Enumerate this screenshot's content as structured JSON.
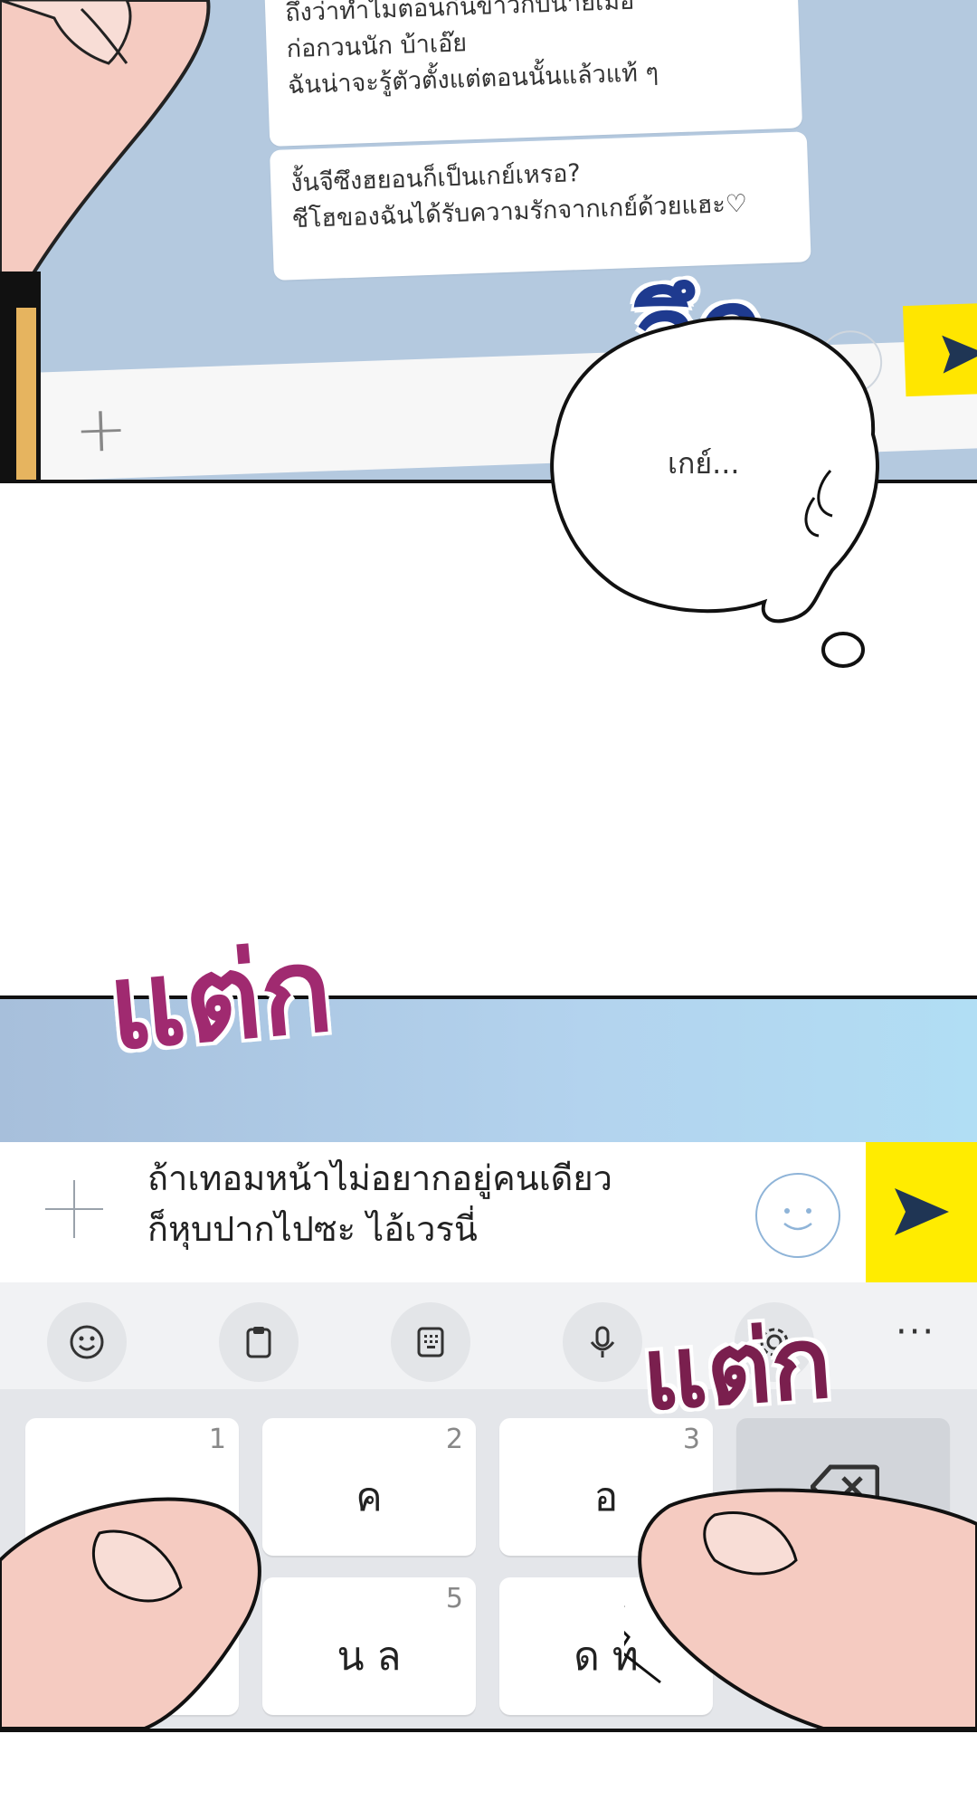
{
  "chat_panel": {
    "message_1": {
      "lines": [
        "ถึงว่าทำไมตอนกินข้าวกับนายเมื่อ",
        "ก่อกวนนัก บ้าเอ๊ย",
        "ฉันน่าจะรู้ตัวตั้งแต่ตอนนั้นแล้วแท้ ๆ"
      ]
    },
    "message_2": {
      "lines": [
        "งั้นจีซึงฮยอนก็เป็นเกย์เหรอ?",
        "ชีโฮของฉันได้รับความรักจากเกย์ด้วยแฮะ♡"
      ]
    }
  },
  "sfx": {
    "uek": "อึก",
    "taek_1": "แต่ก",
    "taek_2": "แต่ก"
  },
  "thought": {
    "text": "เกย์..."
  },
  "keyboard_panel": {
    "typed_lines": [
      "ถ้าเทอมหน้าไม่อยากอยู่คนเดียว",
      "ก็หุบปากไปซะ ไอ้เวรนี่"
    ],
    "toolbar": {
      "icons": [
        "emoji-icon",
        "clipboard-icon",
        "keypad-icon",
        "mic-icon",
        "settings-icon"
      ],
      "more": "···"
    },
    "keys": [
      {
        "num": "1",
        "label": ""
      },
      {
        "num": "2",
        "label": "ค"
      },
      {
        "num": "3",
        "label": "อ"
      },
      {
        "num": "",
        "label": "",
        "icon": "backspace-icon"
      },
      {
        "num": "",
        "label": ""
      },
      {
        "num": "5",
        "label": "น ล"
      },
      {
        "num": "",
        "label": "ด ท"
      }
    ]
  },
  "colors": {
    "send_yellow": "#ffec00",
    "send_arrow": "#1f3554",
    "sfx_blue": "#1e3a8f",
    "sfx_magenta": "#a02a70"
  }
}
